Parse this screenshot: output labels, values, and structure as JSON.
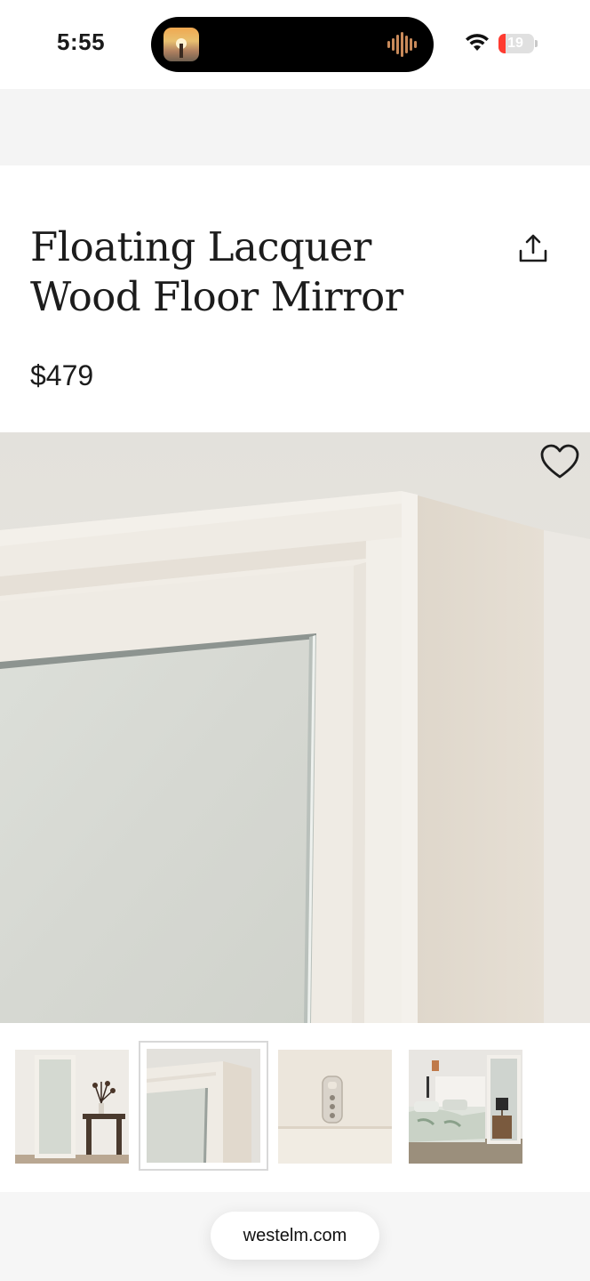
{
  "status_bar": {
    "time": "5:55",
    "battery_level": "19",
    "battery_fill_fraction": 0.19,
    "icons": [
      "now-playing-app-icon",
      "audio-waveform-icon",
      "wifi-icon",
      "battery-icon"
    ]
  },
  "product": {
    "title": "Floating Lacquer Wood Floor Mirror",
    "price": "$479"
  },
  "gallery": {
    "selected_index": 1,
    "thumbnail_count": 4,
    "icons": [
      "share-icon",
      "heart-icon"
    ]
  },
  "browser": {
    "url": "westelm.com"
  },
  "colors": {
    "battery_low": "#ff3b30",
    "text": "#1c1c1c",
    "banner": "#f4f4f4"
  }
}
